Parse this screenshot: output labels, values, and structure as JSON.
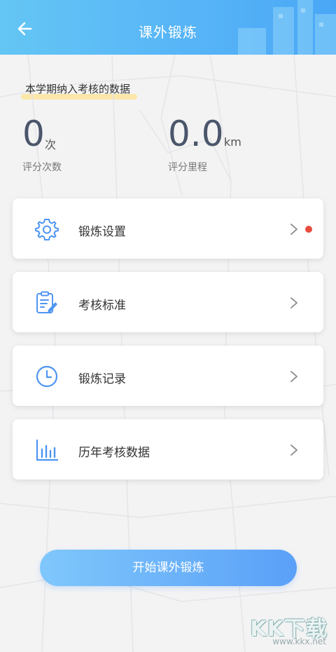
{
  "header": {
    "title": "课外锻炼",
    "back_icon": "arrow-left-icon"
  },
  "stats": {
    "caption": "本学期纳入考核的数据",
    "count": {
      "value": "0",
      "unit": "次",
      "label": "评分次数"
    },
    "distance": {
      "value": "0.0",
      "unit": "km",
      "label": "评分里程"
    }
  },
  "menu": [
    {
      "label": "锻炼设置",
      "icon": "gear-icon",
      "has_badge": true
    },
    {
      "label": "考核标准",
      "icon": "document-edit-icon",
      "has_badge": false
    },
    {
      "label": "锻炼记录",
      "icon": "clock-icon",
      "has_badge": false
    },
    {
      "label": "历年考核数据",
      "icon": "bar-chart-icon",
      "has_badge": false
    }
  ],
  "start_button": "开始课外锻炼",
  "watermark": {
    "logo": "KK下载",
    "url": "www.kkx.net"
  },
  "colors": {
    "accent": "#5aa0f8",
    "icon_blue": "#4e95f2",
    "badge": "#e84c3d",
    "header": "#5ab8f7"
  }
}
